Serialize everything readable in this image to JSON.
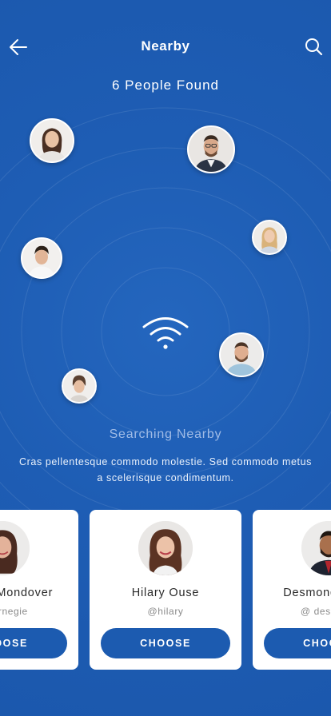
{
  "header": {
    "title": "Nearby",
    "back_icon": "arrow-left-icon",
    "search_icon": "search-icon"
  },
  "results": {
    "count_text": "6 People Found"
  },
  "radar": {
    "status_text": "Searching Nearby",
    "description": "Cras pellentesque commodo molestie. Sed commodo metus a scelerisque condimentum.",
    "center_icon": "wifi-icon",
    "people_on_radar": 6
  },
  "cards": [
    {
      "name": "Tommy Mondover",
      "handle": "@carnegie",
      "button": "CHOOSE"
    },
    {
      "name": "Hilary Ouse",
      "handle": "@hilary",
      "button": "CHOOSE"
    },
    {
      "name": "Desmond Eagle",
      "handle": "@ desmond",
      "button": "CHOOSE"
    }
  ],
  "colors": {
    "background": "#1c5bb0",
    "card": "#ffffff",
    "button": "#1c5bb0",
    "status_text": "#9fbbe6"
  }
}
